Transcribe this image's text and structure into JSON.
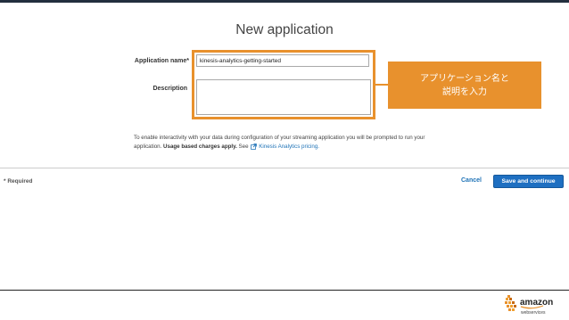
{
  "page": {
    "title": "New application"
  },
  "form": {
    "name_label": "Application name*",
    "name_value": "kinesis-analytics-getting-started",
    "description_label": "Description",
    "description_value": ""
  },
  "callout": {
    "line1": "アプリケーション名と",
    "line2": "説明を入力"
  },
  "info": {
    "text_part1": "To enable interactivity with your data during configuration of your streaming application you will be prompted to run your application. ",
    "bold_text": "Usage based charges apply.",
    "text_part2": " See ",
    "link_text": "Kinesis Analytics pricing."
  },
  "footer": {
    "required_note": "* Required",
    "cancel_label": "Cancel",
    "save_label": "Save and continue"
  },
  "logo": {
    "word": "amazon",
    "subtext": "webservices"
  },
  "colors": {
    "accent_orange": "#e8912d",
    "primary_blue": "#1e6fc1",
    "link_blue": "#1f73b7",
    "top_bar": "#232f3e"
  },
  "icons": [
    "external-link-icon",
    "resize-grip-icon",
    "aws-cubes-icon"
  ]
}
